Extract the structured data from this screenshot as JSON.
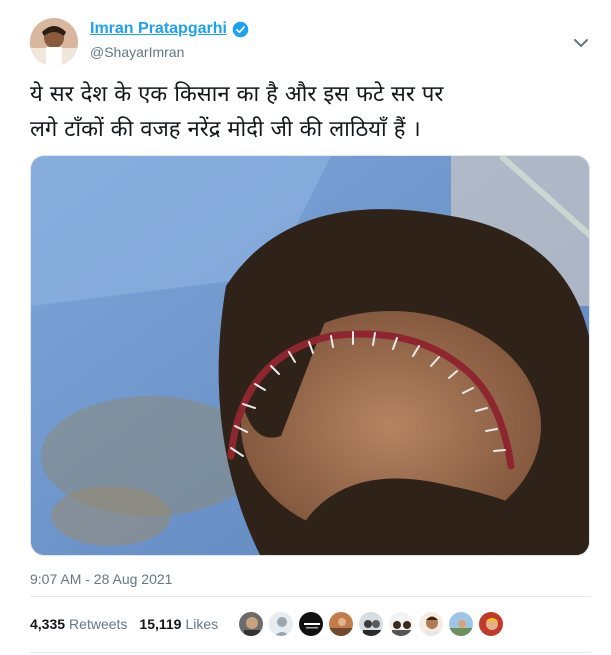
{
  "author": {
    "display_name": "Imran Pratapgarhi",
    "handle": "@ShayarImran",
    "verified": true,
    "avatar_icon": "profile-photo"
  },
  "tweet": {
    "text_line1": "ये सर देश के एक किसान का है और इस फटे सर पर",
    "text_line2": "लगे टाँकों की वजह नरेंद्र मोदी जी की लाठियाँ हैं ।",
    "media_description_icon": "photo-head-wound-stitches",
    "timestamp": "9:07 AM - 28 Aug 2021"
  },
  "stats": {
    "retweets_count": "4,335",
    "retweets_label": "Retweets",
    "likes_count": "15,119",
    "likes_label": "Likes"
  },
  "likers": {
    "count_shown": 9
  },
  "colors": {
    "accent": "#1da1f2",
    "muted": "#657786",
    "text": "#14171a",
    "border": "#e1e8ed"
  }
}
